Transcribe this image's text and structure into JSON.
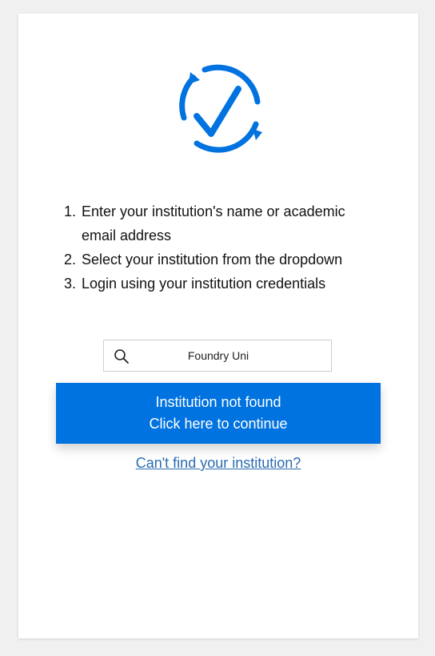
{
  "brand": {
    "logo_icon": "circular-checkmark-icon",
    "color": "#0073e0"
  },
  "steps": [
    {
      "num": "1.",
      "text": "Enter your institution's name or academic",
      "text2": "email address"
    },
    {
      "num": "2.",
      "text": "Select your institution from the dropdown"
    },
    {
      "num": "3.",
      "text": "Login using your institution credentials"
    }
  ],
  "search": {
    "icon": "search-icon",
    "value": "Foundry Uni"
  },
  "result_button": {
    "line1": "Institution not found",
    "line2": "Click here to continue"
  },
  "help_link": {
    "label": "Can't find your institution?"
  }
}
